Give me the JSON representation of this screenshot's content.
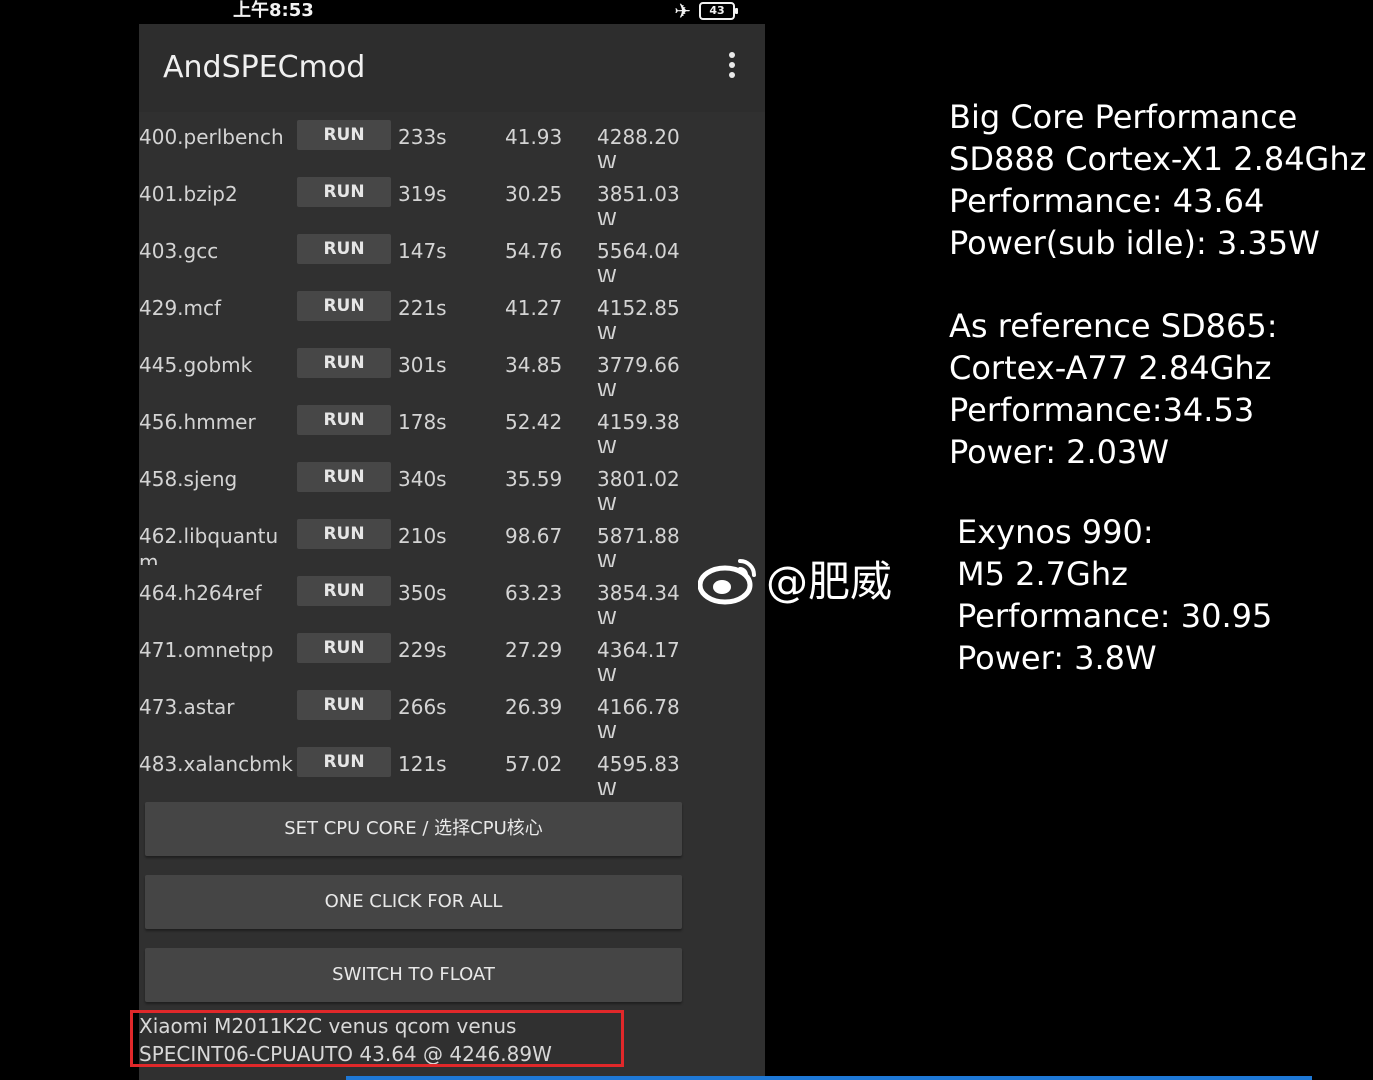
{
  "status": {
    "time": "上午8:53",
    "battery": "43"
  },
  "app": {
    "title": "AndSPECmod"
  },
  "benchmarks": [
    {
      "name": "400.perlbench",
      "run": "RUN",
      "time": "233s",
      "score": "41.93",
      "energy": "4288.20 W"
    },
    {
      "name": "401.bzip2",
      "run": "RUN",
      "time": "319s",
      "score": "30.25",
      "energy": "3851.03 W"
    },
    {
      "name": "403.gcc",
      "run": "RUN",
      "time": "147s",
      "score": "54.76",
      "energy": "5564.04 W"
    },
    {
      "name": "429.mcf",
      "run": "RUN",
      "time": "221s",
      "score": "41.27",
      "energy": "4152.85 W"
    },
    {
      "name": "445.gobmk",
      "run": "RUN",
      "time": "301s",
      "score": "34.85",
      "energy": "3779.66 W"
    },
    {
      "name": "456.hmmer",
      "run": "RUN",
      "time": "178s",
      "score": "52.42",
      "energy": "4159.38 W"
    },
    {
      "name": "458.sjeng",
      "run": "RUN",
      "time": "340s",
      "score": "35.59",
      "energy": "3801.02 W"
    },
    {
      "name": "462.libquantum",
      "run": "RUN",
      "time": "210s",
      "score": "98.67",
      "energy": "5871.88 W"
    },
    {
      "name": "464.h264ref",
      "run": "RUN",
      "time": "350s",
      "score": "63.23",
      "energy": "3854.34 W"
    },
    {
      "name": "471.omnetpp",
      "run": "RUN",
      "time": "229s",
      "score": "27.29",
      "energy": "4364.17 W"
    },
    {
      "name": "473.astar",
      "run": "RUN",
      "time": "266s",
      "score": "26.39",
      "energy": "4166.78 W"
    },
    {
      "name": "483.xalancbmk",
      "run": "RUN",
      "time": "121s",
      "score": "57.02",
      "energy": "4595.83 W"
    }
  ],
  "buttons": {
    "set_cpu": "SET CPU CORE / 选择CPU核心",
    "one_click": "ONE CLICK FOR ALL",
    "switch_float": "SWITCH TO FLOAT"
  },
  "footer": {
    "device": "Xiaomi M2011K2C venus qcom venus",
    "result": "SPECINT06-CPUAUTO  43.64 @ 4246.89W"
  },
  "watermark": "@肥威",
  "notes": {
    "block1": [
      "Big Core Performance",
      "SD888 Cortex-X1 2.84Ghz",
      "Performance: 43.64",
      "Power(sub idle): 3.35W"
    ],
    "block2": [
      "As reference SD865:",
      "Cortex-A77 2.84Ghz",
      "Performance:34.53",
      "Power: 2.03W"
    ],
    "block3": [
      "Exynos 990:",
      "M5 2.7Ghz",
      "Performance: 30.95",
      "Power: 3.8W"
    ]
  },
  "colors": {
    "highlight": "#e0282a",
    "accent_line": "#1e78d6"
  }
}
